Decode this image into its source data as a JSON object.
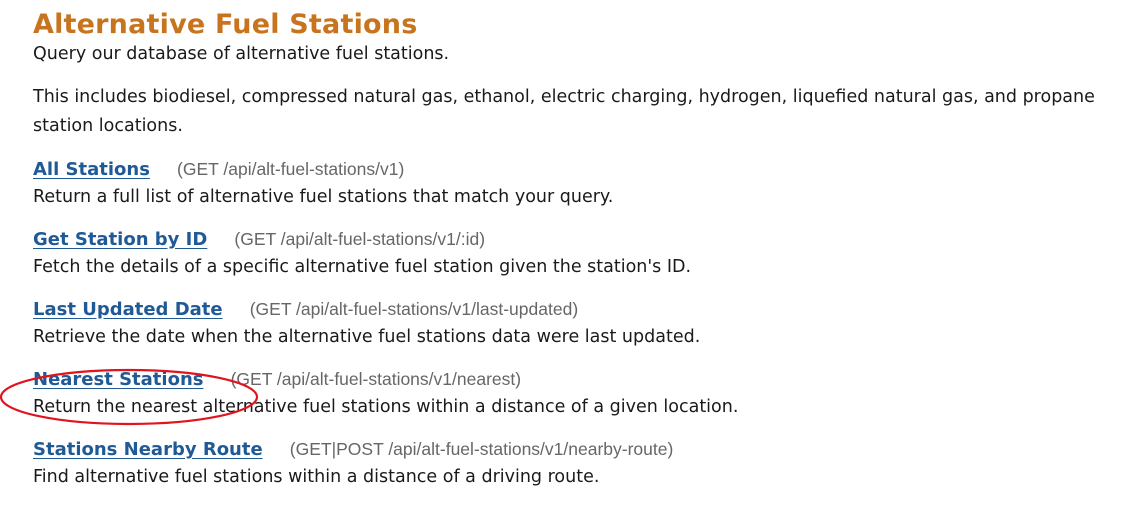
{
  "page": {
    "title": "Alternative Fuel Stations",
    "intro": "Query our database of alternative fuel stations.",
    "includes": "This includes biodiesel, compressed natural gas, ethanol, electric charging, hydrogen, liquefied natural gas, and propane station locations."
  },
  "endpoints": [
    {
      "label": "All Stations",
      "route": "(GET /api/alt-fuel-stations/v1)",
      "description": "Return a full list of alternative fuel stations that match your query."
    },
    {
      "label": "Get Station by ID",
      "route": "(GET /api/alt-fuel-stations/v1/:id)",
      "description": "Fetch the details of a specific alternative fuel station given the station's ID."
    },
    {
      "label": "Last Updated Date",
      "route": "(GET /api/alt-fuel-stations/v1/last-updated)",
      "description": "Retrieve the date when the alternative fuel stations data were last updated."
    },
    {
      "label": "Nearest Stations",
      "route": "(GET /api/alt-fuel-stations/v1/nearest)",
      "description": "Return the nearest alternative fuel stations within a distance of a given location."
    },
    {
      "label": "Stations Nearby Route",
      "route": "(GET|POST /api/alt-fuel-stations/v1/nearby-route)",
      "description": "Find alternative fuel stations within a distance of a driving route."
    }
  ],
  "colors": {
    "title": "#c8741f",
    "link": "#1f5a96",
    "route": "#666666",
    "annotation": "#e0141e"
  }
}
